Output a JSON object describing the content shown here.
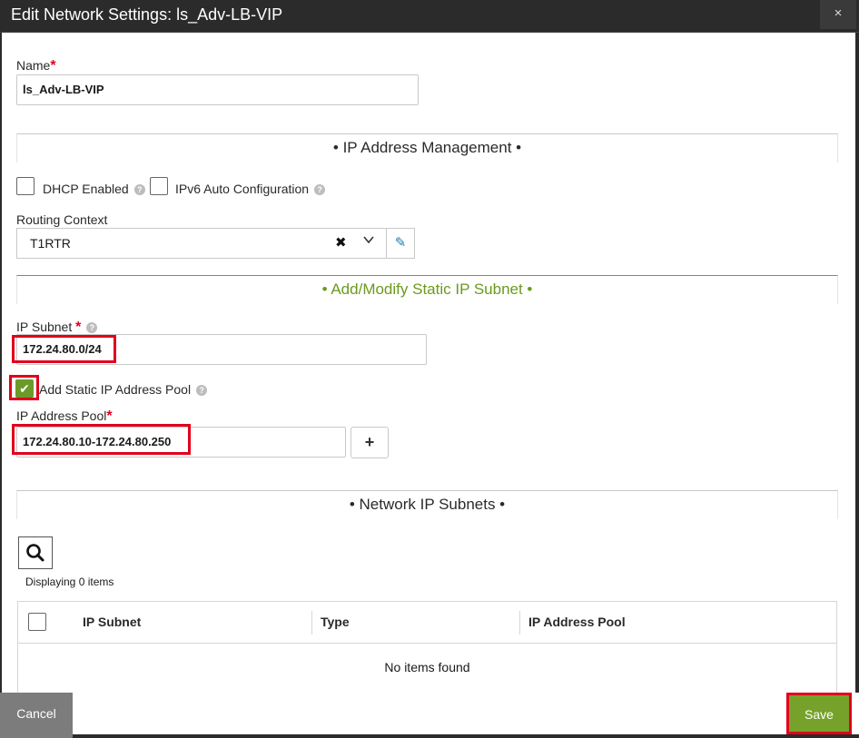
{
  "dialog": {
    "title": "Edit Network Settings: ls_Adv-LB-VIP",
    "close_label": "×"
  },
  "name_field": {
    "label": "Name",
    "required_mark": "*",
    "value": "ls_Adv-LB-VIP"
  },
  "ip_management": {
    "section_title": "• IP Address Management •",
    "dhcp_label": "DHCP Enabled",
    "dhcp_checked": false,
    "ipv6_label": "IPv6 Auto Configuration",
    "ipv6_checked": false,
    "help_icon": "?"
  },
  "routing_context": {
    "label": "Routing Context",
    "value": "T1RTR",
    "clear_icon": "✖",
    "chevron_icon": "⌄",
    "edit_icon": "✎"
  },
  "static_subnet": {
    "section_title": "• Add/Modify Static IP Subnet •",
    "ip_subnet_label": "IP Subnet",
    "ip_subnet_value": "172.24.80.0/24",
    "add_pool_label": "Add Static IP Address Pool",
    "add_pool_checked": true,
    "check_glyph": "✔",
    "pool_label": "IP Address Pool",
    "pool_value": "172.24.80.10-172.24.80.250",
    "add_button_label": "+"
  },
  "network_subnets": {
    "section_title": "• Network IP Subnets •",
    "display_count": "Displaying 0 items",
    "columns": [
      "IP Subnet",
      "Type",
      "IP Address Pool"
    ],
    "empty_message": "No items found"
  },
  "footer": {
    "cancel_label": "Cancel",
    "save_label": "Save"
  },
  "colors": {
    "accent_green": "#76a22b",
    "highlight_red": "#e0001b",
    "titlebar": "#2b2b2b"
  }
}
